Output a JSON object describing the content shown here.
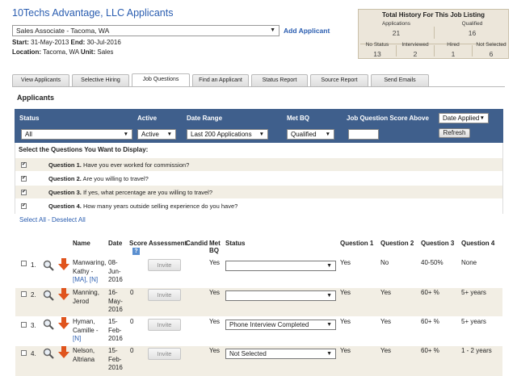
{
  "header": {
    "title": "10Techs Advantage, LLC Applicants",
    "job_select": "Sales Associate - Tacoma, WA",
    "add_applicant": "Add Applicant",
    "start_label": "Start:",
    "start_value": "31-May-2013",
    "end_label": "End:",
    "end_value": "30-Jul-2016",
    "location_label": "Location:",
    "location_value": "Tacoma, WA",
    "unit_label": "Unit:",
    "unit_value": "Sales"
  },
  "history": {
    "title": "Total History For This Job Listing",
    "applications_label": "Applications",
    "applications": "21",
    "qualified_label": "Qualified",
    "qualified": "16",
    "no_status_label": "No Status",
    "no_status": "13",
    "interviewed_label": "Interviewed",
    "interviewed": "2",
    "hired_label": "Hired",
    "hired": "1",
    "not_selected_label": "Not Selected",
    "not_selected": "6"
  },
  "tabs": [
    {
      "label": "View Applicants"
    },
    {
      "label": "Selective Hiring"
    },
    {
      "label": "Job Questions"
    },
    {
      "label": "Find an Applicant"
    },
    {
      "label": "Status Report"
    },
    {
      "label": "Source Report"
    },
    {
      "label": "Send Emails"
    }
  ],
  "section_title": "Applicants",
  "filters": {
    "status_label": "Status",
    "status_value": "All",
    "active_label": "Active",
    "active_value": "Active",
    "date_range_label": "Date Range",
    "date_range_value": "Last 200 Applications",
    "met_bq_label": "Met BQ",
    "met_bq_value": "Qualified",
    "score_label": "Job Question Score Above",
    "score_value": "",
    "sort_value": "Date Applied",
    "refresh_label": "Refresh"
  },
  "questions": {
    "heading": "Select the Questions You Want to Display:",
    "items": [
      {
        "label": "Question 1.",
        "text": "Have you ever worked for commission?"
      },
      {
        "label": "Question 2.",
        "text": "Are you willing to travel?"
      },
      {
        "label": "Question 3.",
        "text": "If yes, what percentage are you willing to travel?"
      },
      {
        "label": "Question 4.",
        "text": "How many years outside selling experience do you have?"
      }
    ],
    "select_all": "Select All",
    "separator": " - ",
    "deselect_all": "Deselect All"
  },
  "table": {
    "headers": {
      "name": "Name",
      "date": "Date",
      "score": "Score",
      "assessment": "Assessment",
      "candid": "Candid",
      "met_bq_1": "Met",
      "met_bq_2": "BQ",
      "status": "Status",
      "q1": "Question 1",
      "q2": "Question 2",
      "q3": "Question 3",
      "q4": "Question 4"
    },
    "help_icon": "?",
    "invite_label": "Invite",
    "rows": [
      {
        "num": "1.",
        "name1": "Manwaring,",
        "name2": "Kathy -",
        "links": "[MA], [N]",
        "date1": "08-",
        "date2": "Jun-",
        "date3": "2016",
        "score": "",
        "met_bq": "Yes",
        "status": "",
        "q1": "Yes",
        "q2": "No",
        "q3": "40-50%",
        "q4": "None"
      },
      {
        "num": "2.",
        "name1": "Manning,",
        "name2": "Jerod",
        "links": "",
        "date1": "16-",
        "date2": "May-",
        "date3": "2016",
        "score": "0",
        "met_bq": "Yes",
        "status": "",
        "q1": "Yes",
        "q2": "Yes",
        "q3": "60+ %",
        "q4": "5+ years"
      },
      {
        "num": "3.",
        "name1": "Hyman,",
        "name2": "Camille -",
        "links": "[N]",
        "date1": "15-",
        "date2": "Feb-",
        "date3": "2016",
        "score": "0",
        "met_bq": "Yes",
        "status": "Phone Interview Completed",
        "q1": "Yes",
        "q2": "Yes",
        "q3": "60+ %",
        "q4": "5+ years"
      },
      {
        "num": "4.",
        "name1": "Nelson,",
        "name2": "Altriana",
        "links": "",
        "date1": "15-",
        "date2": "Feb-",
        "date3": "2016",
        "score": "0",
        "met_bq": "Yes",
        "status": "Not Selected",
        "q1": "Yes",
        "q2": "Yes",
        "q3": "60+ %",
        "q4": "1 - 2 years"
      }
    ]
  },
  "icons": {
    "magnifier": "magnifier-icon",
    "arrow": "down-arrow-icon",
    "arrow_color": "#e0541d",
    "filter_bar_color": "#3f5f8c",
    "title_color": "#2a5db0"
  }
}
